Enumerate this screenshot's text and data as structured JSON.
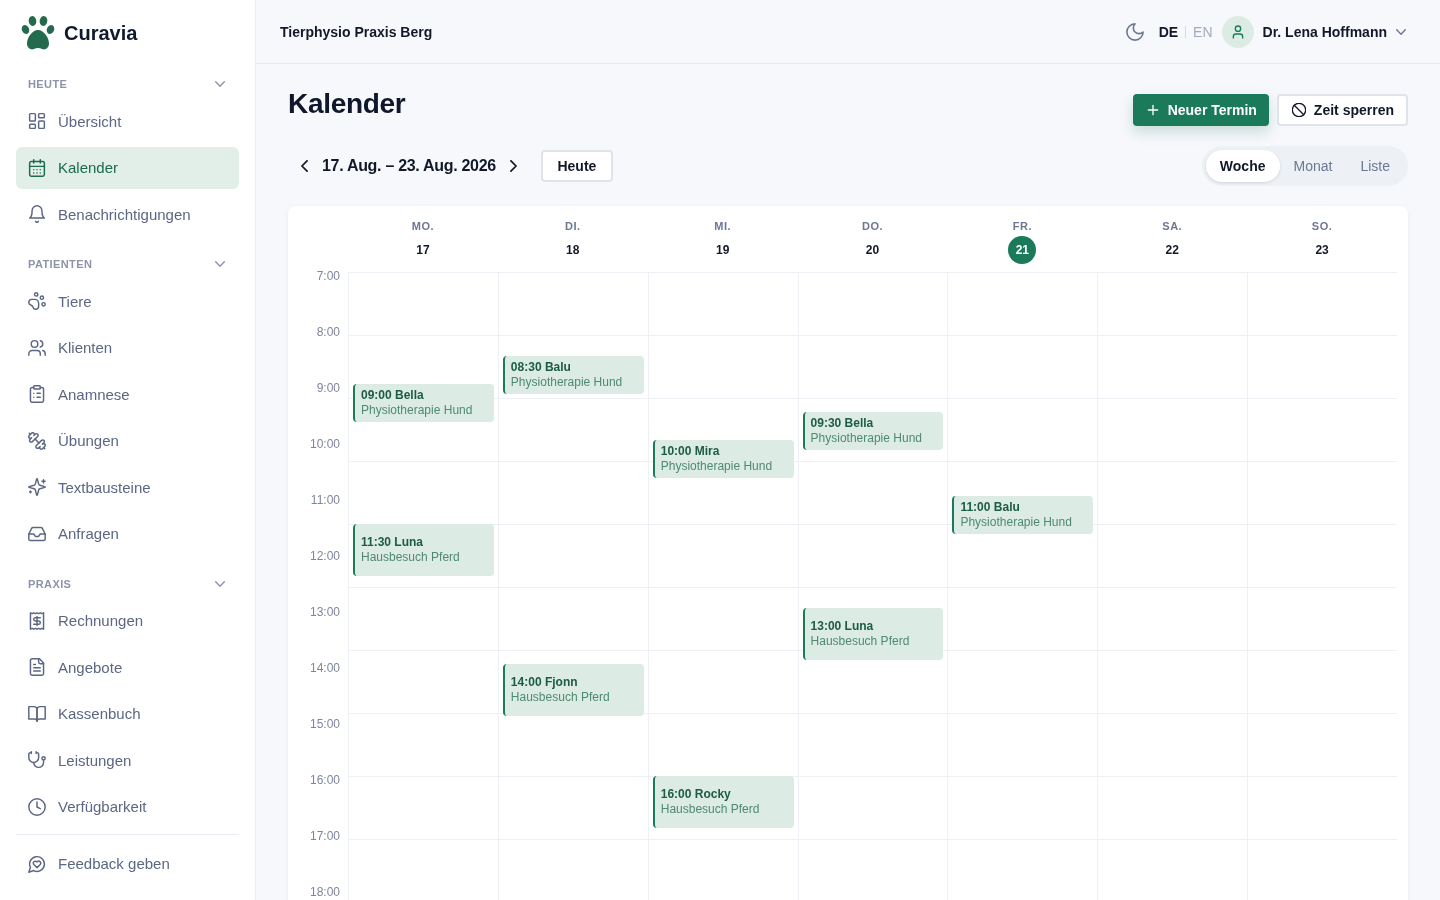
{
  "sidebar": {
    "brand": "Curavia",
    "sections": [
      {
        "title": "HEUTE",
        "expanded": true,
        "items": [
          {
            "label": "Übersicht",
            "selected": false
          },
          {
            "label": "Kalender",
            "selected": true
          },
          {
            "label": "Benachrichtigungen",
            "selected": false
          }
        ]
      },
      {
        "title": "PATIENTEN",
        "expanded": true,
        "items": [
          {
            "label": "Tiere",
            "selected": false
          },
          {
            "label": "Klienten",
            "selected": false
          },
          {
            "label": "Anamnese",
            "selected": false
          },
          {
            "label": "Übungen",
            "selected": false
          },
          {
            "label": "Textbausteine",
            "selected": false
          },
          {
            "label": "Anfragen",
            "selected": false
          }
        ]
      },
      {
        "title": "PRAXIS",
        "expanded": true,
        "items": [
          {
            "label": "Rechnungen",
            "selected": false
          },
          {
            "label": "Angebote",
            "selected": false
          },
          {
            "label": "Kassenbuch",
            "selected": false
          },
          {
            "label": "Leistungen",
            "selected": false
          },
          {
            "label": "Verfügbarkeit",
            "selected": false
          }
        ]
      }
    ],
    "footer_item": {
      "label": "Feedback geben"
    }
  },
  "top_bar": {
    "practice_name": "Tierphysio Praxis Berg",
    "languages": [
      {
        "label": "DE",
        "selected": true
      },
      {
        "label": "EN",
        "selected": false
      }
    ],
    "user_name": "Dr. Lena Hoffmann"
  },
  "page": {
    "title": "Kalender",
    "actions": [
      {
        "label": "Neuer Termin",
        "kind": "primary"
      },
      {
        "label": "Zeit sperren",
        "kind": "block"
      }
    ]
  },
  "toolbar": {
    "date_range": "17. Aug. – 23. Aug. 2026",
    "today_button": "Heute",
    "view_tabs": [
      {
        "label": "Woche",
        "selected": true
      },
      {
        "label": "Monat",
        "selected": false
      },
      {
        "label": "Liste",
        "selected": false
      }
    ]
  },
  "calendar": {
    "hours": [
      "7:00",
      "8:00",
      "9:00",
      "10:00",
      "11:00",
      "12:00",
      "13:00",
      "14:00",
      "15:00",
      "16:00",
      "17:00",
      "18:00"
    ],
    "days": [
      {
        "weekday": "MO.",
        "date": "17",
        "today": false,
        "events": [
          {
            "title": "09:00 Bella",
            "type": "Physiotherapie Hund",
            "kind": "session"
          },
          {
            "title": "11:30 Luna",
            "type": "Hausbesuch Pferd",
            "kind": "visit"
          }
        ]
      },
      {
        "weekday": "DI.",
        "date": "18",
        "today": false,
        "events": [
          {
            "title": "08:30 Balu",
            "type": "Physiotherapie Hund",
            "kind": "session"
          },
          {
            "title": "14:00 Fjonn",
            "type": "Hausbesuch Pferd",
            "kind": "visit"
          }
        ]
      },
      {
        "weekday": "MI.",
        "date": "19",
        "today": false,
        "events": [
          {
            "title": "10:00 Mira",
            "type": "Physiotherapie Hund",
            "kind": "session"
          },
          {
            "title": "16:00 Rocky",
            "type": "Hausbesuch Pferd",
            "kind": "visit"
          }
        ]
      },
      {
        "weekday": "DO.",
        "date": "20",
        "today": false,
        "events": [
          {
            "title": "09:30 Bella",
            "type": "Physiotherapie Hund",
            "kind": "session"
          },
          {
            "title": "13:00 Luna",
            "type": "Hausbesuch Pferd",
            "kind": "visit"
          }
        ]
      },
      {
        "weekday": "FR.",
        "date": "21",
        "today": true,
        "events": [
          {
            "title": "11:00 Balu",
            "type": "Physiotherapie Hund",
            "kind": "session"
          }
        ]
      },
      {
        "weekday": "SA.",
        "date": "22",
        "today": false
      },
      {
        "weekday": "SO.",
        "date": "23",
        "today": false
      }
    ]
  }
}
